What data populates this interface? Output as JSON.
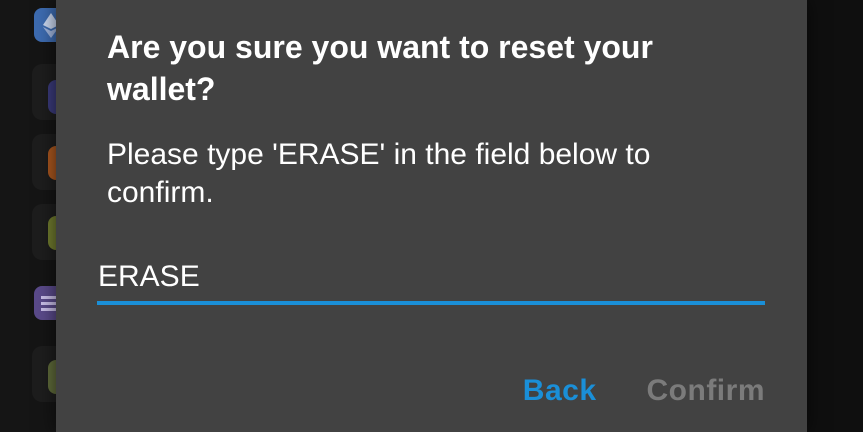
{
  "dialog": {
    "title": "Are you sure you want to reset your wallet?",
    "message": "Please type 'ERASE' in the field below to confirm.",
    "input_value": "ERASE",
    "back_label": "Back",
    "confirm_label": "Confirm"
  },
  "colors": {
    "accent": "#1a8fd8",
    "dialog_bg": "#424242",
    "disabled_text": "#7b7b7b"
  },
  "background_icons": [
    "ethereum-icon",
    "coin-icon",
    "coin-icon",
    "coin-icon",
    "stack-icon",
    "coin-icon"
  ]
}
